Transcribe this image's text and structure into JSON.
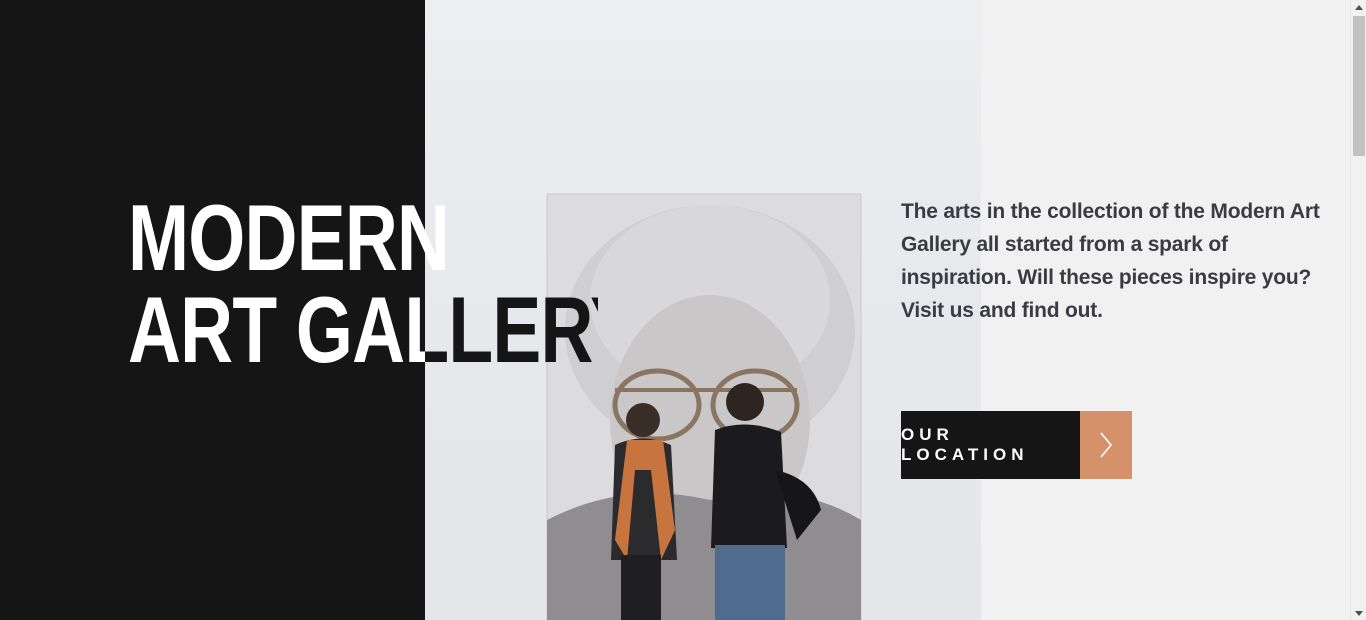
{
  "hero": {
    "headline_line1": "MODERN",
    "headline_line2": "ART GALLERY",
    "intro": "The arts in the collection of the Modern Art Gallery all started from a spark of inspiration. Will these pieces inspire you? Visit us and find out.",
    "cta_label": "OUR LOCATION",
    "cta_icon": "chevron-right-icon"
  },
  "colors": {
    "dark": "#151515",
    "background": "#f1f1f1",
    "accent": "#d5926a",
    "body_text": "#3b3b42"
  },
  "scrollbar": {
    "up_icon": "arrow-up-icon",
    "down_icon": "arrow-down-icon"
  }
}
